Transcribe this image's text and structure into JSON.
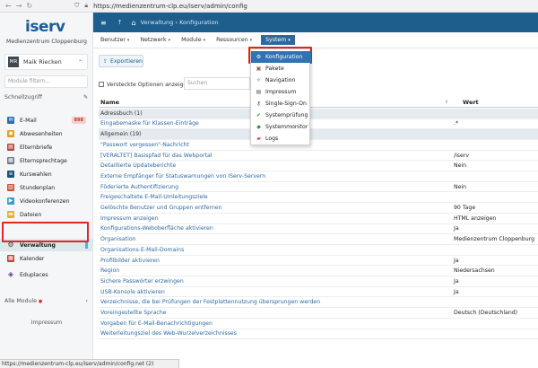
{
  "browser": {
    "url": "https://medienzentrum-clp.eu/iserv/admin/config"
  },
  "sidebar": {
    "logo": "iserv",
    "school": "Medienzentrum Cloppenburg",
    "user_initials": "MR",
    "user_name": "Maik Riecken",
    "module_filter_placeholder": "Module filtern...",
    "quick_access": "Schnellzugriff",
    "items": [
      {
        "label": "E-Mail",
        "badge": "898"
      },
      {
        "label": "Abwesenheiten"
      },
      {
        "label": "Elternbriefe"
      },
      {
        "label": "Elternsprechtage"
      },
      {
        "label": "Kurswahlen"
      },
      {
        "label": "Stundenplan"
      },
      {
        "label": "Videokonferenzen"
      },
      {
        "label": "Dateien"
      },
      {
        "label": "Verwaltung"
      },
      {
        "label": "Kalender"
      },
      {
        "label": "Eduplaces"
      }
    ],
    "all_modules": "Alle Module",
    "impressum": "Impressum"
  },
  "header": {
    "breadcrumb_1": "Verwaltung",
    "breadcrumb_sep": "›",
    "breadcrumb_2": "Konfiguration"
  },
  "subnav": {
    "tabs": [
      "Benutzer",
      "Netzwerk",
      "Module",
      "Ressourcen",
      "System"
    ]
  },
  "dropdown": {
    "items": [
      "Konfiguration",
      "Pakete",
      "Navigation",
      "Impressum",
      "Single-Sign-On",
      "Systemprüfung",
      "Systemmonitor",
      "Logs"
    ]
  },
  "toolbar": {
    "export_label": "Exportieren",
    "hidden_options_label": "Versteckte Optionen anzeigen",
    "search_placeholder": "Suchen"
  },
  "table": {
    "col_name": "Name",
    "col_value": "Wert",
    "rows": [
      {
        "name": "Adressbuch (1)",
        "value": "",
        "group": true
      },
      {
        "name": "Eingabemaske für Klassen-Einträge",
        "value": ".*"
      },
      {
        "name": "Allgemein (19)",
        "value": "",
        "group": true
      },
      {
        "name": "\"Passwort vergessen\"-Nachricht",
        "value": ""
      },
      {
        "name": "[VERALTET] Basispfad für das Webportal",
        "value": "/iserv"
      },
      {
        "name": "Detaillierte Updateberichte",
        "value": "Nein"
      },
      {
        "name": "Externe Empfänger für Statuswarnungen von IServ-Servern",
        "value": ""
      },
      {
        "name": "Föderierte Authentifizierung",
        "value": "Nein"
      },
      {
        "name": "Freigeschaltete E-Mail-Umleitungsziele",
        "value": ""
      },
      {
        "name": "Gelöschte Benutzer und Gruppen entfernen",
        "value": "90 Tage"
      },
      {
        "name": "Impressum anzeigen",
        "value": "HTML anzeigen"
      },
      {
        "name": "Konfigurations-Weboberfläche aktivieren",
        "value": "Ja"
      },
      {
        "name": "Organisation",
        "value": "Medienzentrum Cloppenburg"
      },
      {
        "name": "Organisations-E-Mail-Domains",
        "value": ""
      },
      {
        "name": "Profilbilder aktivieren",
        "value": "Ja"
      },
      {
        "name": "Region",
        "value": "Niedersachsen"
      },
      {
        "name": "Sichere Passwörter erzwingen",
        "value": "Ja"
      },
      {
        "name": "USB-Konsole aktivieren",
        "value": "Ja"
      },
      {
        "name": "Verzeichnisse, die bei Prüfungen der Festplattennutzung übersprungen werden",
        "value": ""
      },
      {
        "name": "Voreingestellte Sprache",
        "value": "Deutsch (Deutschland)"
      },
      {
        "name": "Vorgaben für E-Mail-Benachrichtigungen",
        "value": ""
      },
      {
        "name": "Weiterleitungsziel des Web-Wurzelverzeichnisses",
        "value": ""
      }
    ]
  },
  "statusbar": {
    "text": "https://medienzentrum-clp.eu/iserv/admin/config.net (2)"
  }
}
